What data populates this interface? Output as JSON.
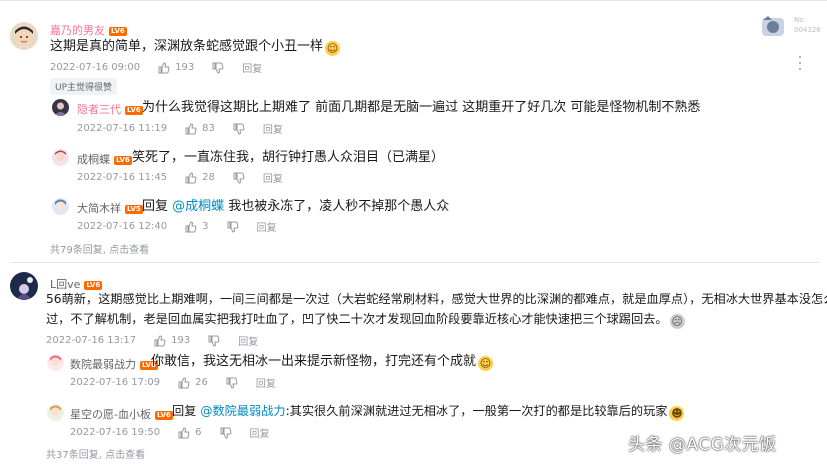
{
  "comments": [
    {
      "username": "嘉乃的男友",
      "level": "LV6",
      "text": "这期是真的简单，深渊放条蛇感觉跟个小丑一样",
      "emoji": "smile-emoji",
      "time": "2022-07-16 09:00",
      "likes": "193",
      "reply_label": "回复",
      "up_badge": "UP主觉得很赞",
      "fan_badge": {
        "label": "No.",
        "number": "004326"
      },
      "replies": [
        {
          "username": "隐者三代",
          "level": "LV6",
          "text": "为什么我觉得这期比上期难了 前面几期都是无脑一遍过 这期重开了好几次 可能是怪物机制不熟悉",
          "time": "2022-07-16 11:19",
          "likes": "83",
          "reply_label": "回复"
        },
        {
          "username": "成桐蝶",
          "level": "LV6",
          "text": "笑死了，一直冻住我，胡行钟打愚人众泪目（已满星）",
          "time": "2022-07-16 11:45",
          "likes": "28",
          "reply_label": "回复"
        },
        {
          "username": "大简木祥",
          "level": "LV5",
          "reply_prefix": "回复 ",
          "mention": "@成桐蝶",
          "text": " 我也被永冻了，凌人秒不掉那个愚人众",
          "time": "2022-07-16 12:40",
          "likes": "3",
          "reply_label": "回复"
        }
      ],
      "more_replies": "共79条回复, 点击查看"
    },
    {
      "username": "L回ve",
      "level": "LV6",
      "text_line1": "56萌新，这期感觉比上期难啊，一间三间都是一次过（大岩蛇经常刷材料，感觉大世界的比深渊的都难点，就是血厚点），无相冰大世界基本没怎么打",
      "text_line2": "过，不了解机制，老是回血属实把我打吐血了，凹了快二十次才发现回血阶段要靠近核心才能快速把三个球踢回去。",
      "time": "2022-07-16 13:17",
      "likes": "193",
      "reply_label": "回复",
      "replies": [
        {
          "username": "数院最弱战力",
          "level": "LV6",
          "text": "你敢信，我这无相冰一出来提示新怪物，打完还有个成就",
          "time": "2022-07-16 17:09",
          "likes": "26",
          "reply_label": "回复"
        },
        {
          "username": "星空の愿-血小板",
          "level": "LV6",
          "reply_prefix": "回复 ",
          "mention": "@数院最弱战力",
          "text": ":其实很久前深渊就进过无相冰了，一般第一次打的都是比较靠后的玩家",
          "time": "2022-07-16 19:50",
          "likes": "6",
          "reply_label": "回复"
        }
      ],
      "more_replies": "共37条回复, 点击查看"
    }
  ],
  "watermark": "头条 @ACG次元饭",
  "colors": {
    "username_pink": "#fb7299",
    "mention_blue": "#008ac5",
    "level_orange": "#ff6a00",
    "meta_gray": "#9499a0"
  }
}
